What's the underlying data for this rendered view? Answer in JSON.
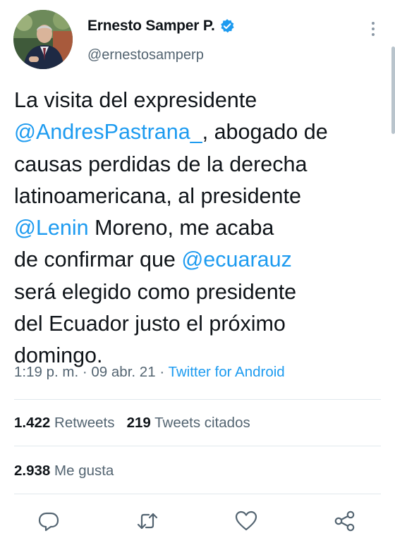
{
  "author": {
    "display_name": "Ernesto Samper P.",
    "handle": "@ernestosamperp",
    "verified": true,
    "verified_icon": "verified-badge-icon",
    "avatar_icon": "avatar-photo"
  },
  "tweet": {
    "lines": [
      [
        {
          "text": "La visita del expresidente",
          "type": "text"
        }
      ],
      [
        {
          "text": "@AndresPastrana_",
          "type": "mention"
        },
        {
          "text": ", abogado de",
          "type": "text"
        }
      ],
      [
        {
          "text": "causas perdidas de la derecha",
          "type": "text"
        }
      ],
      [
        {
          "text": "latinoamericana, al presidente",
          "type": "text"
        }
      ],
      [
        {
          "text": "@Lenin",
          "type": "mention"
        },
        {
          "text": " Moreno, me acaba",
          "type": "text"
        }
      ],
      [
        {
          "text": "de confirmar que ",
          "type": "text"
        },
        {
          "text": "@ecuarauz",
          "type": "mention"
        }
      ],
      [
        {
          "text": "será elegido como  presidente",
          "type": "text"
        }
      ],
      [
        {
          "text": "del Ecuador justo el próximo",
          "type": "text"
        }
      ],
      [
        {
          "text": "domingo.",
          "type": "text"
        }
      ]
    ]
  },
  "meta": {
    "time": "1:19 p. m.",
    "separator": "·",
    "date": "09 abr. 21",
    "source": "Twitter for Android"
  },
  "stats": {
    "retweets_count": "1.422",
    "retweets_label": "Retweets",
    "quotes_count": "219",
    "quotes_label": "Tweets citados",
    "likes_count": "2.938",
    "likes_label": "Me gusta"
  },
  "actions": {
    "reply_icon": "reply-icon",
    "retweet_icon": "retweet-icon",
    "like_icon": "like-icon",
    "share_icon": "share-icon"
  },
  "colors": {
    "accent": "#1d9bf0",
    "text": "#0f1419",
    "secondary": "#536471",
    "divider": "#e1e8ed"
  }
}
